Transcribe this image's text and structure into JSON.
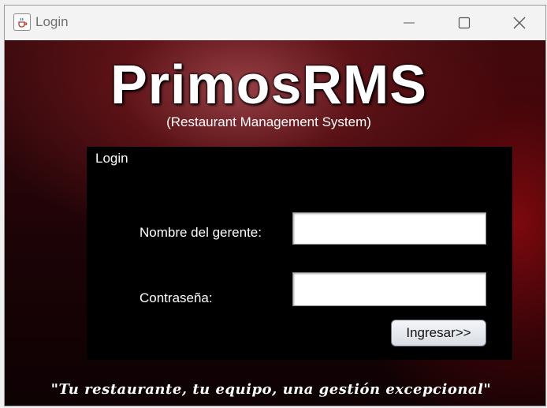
{
  "window": {
    "title": "Login",
    "controls": {
      "minimize_icon": "minimize-icon",
      "maximize_icon": "maximize-icon",
      "close_icon": "close-icon"
    },
    "app_icon": "java-cup-icon"
  },
  "brand": {
    "name": "PrimosRMS",
    "subtitle": "(Restaurant Management System)"
  },
  "login_panel": {
    "title": "Login",
    "username_label": "Nombre del gerente:",
    "username_value": "",
    "password_label": "Contraseña:",
    "password_value": "",
    "submit_label": "Ingresar>>"
  },
  "slogan": "\"Tu restaurante, tu equipo, una gestión excepcional\"",
  "colors": {
    "background_dark_red": "#3a0a0d",
    "panel": "#000000",
    "text": "#ffffff"
  }
}
